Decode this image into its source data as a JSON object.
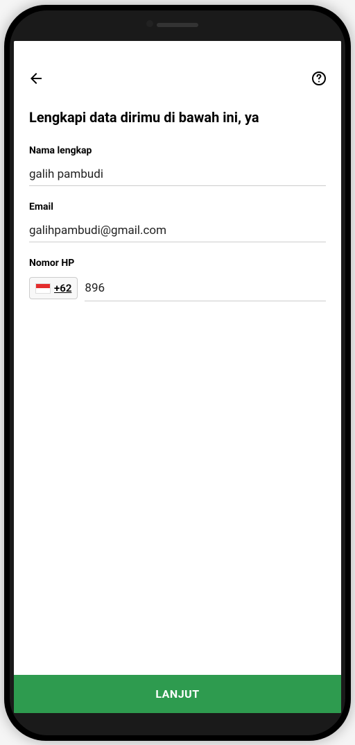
{
  "title": "Lengkapi data dirimu di bawah ini, ya",
  "form": {
    "name": {
      "label": "Nama lengkap",
      "value": "galih pambudi"
    },
    "email": {
      "label": "Email",
      "value": "galihpambudi@gmail.com"
    },
    "phone": {
      "label": "Nomor HP",
      "country_code": "+62",
      "value": "896"
    }
  },
  "submit_label": "LANJUT"
}
